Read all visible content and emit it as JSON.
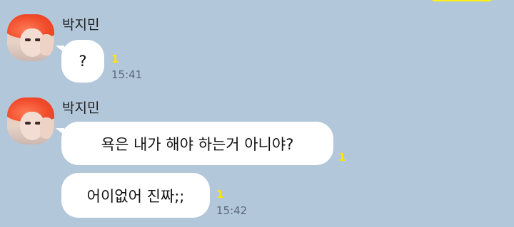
{
  "messages": [
    {
      "sender": "박지민",
      "avatar_icon": "profile-photo",
      "bubbles": [
        {
          "text": "?",
          "unread": "1",
          "time": "15:41"
        }
      ]
    },
    {
      "sender": "박지민",
      "avatar_icon": "profile-photo",
      "bubbles": [
        {
          "text": "욕은 내가 해야 하는거 아니야?",
          "unread": "1"
        },
        {
          "text": "어이없어 진짜;;",
          "unread": "1",
          "time": "15:42"
        }
      ]
    }
  ],
  "colors": {
    "background": "#b2c7da",
    "bubble": "#ffffff",
    "unread": "#ffe400",
    "own_bubble": "#fef01b"
  }
}
